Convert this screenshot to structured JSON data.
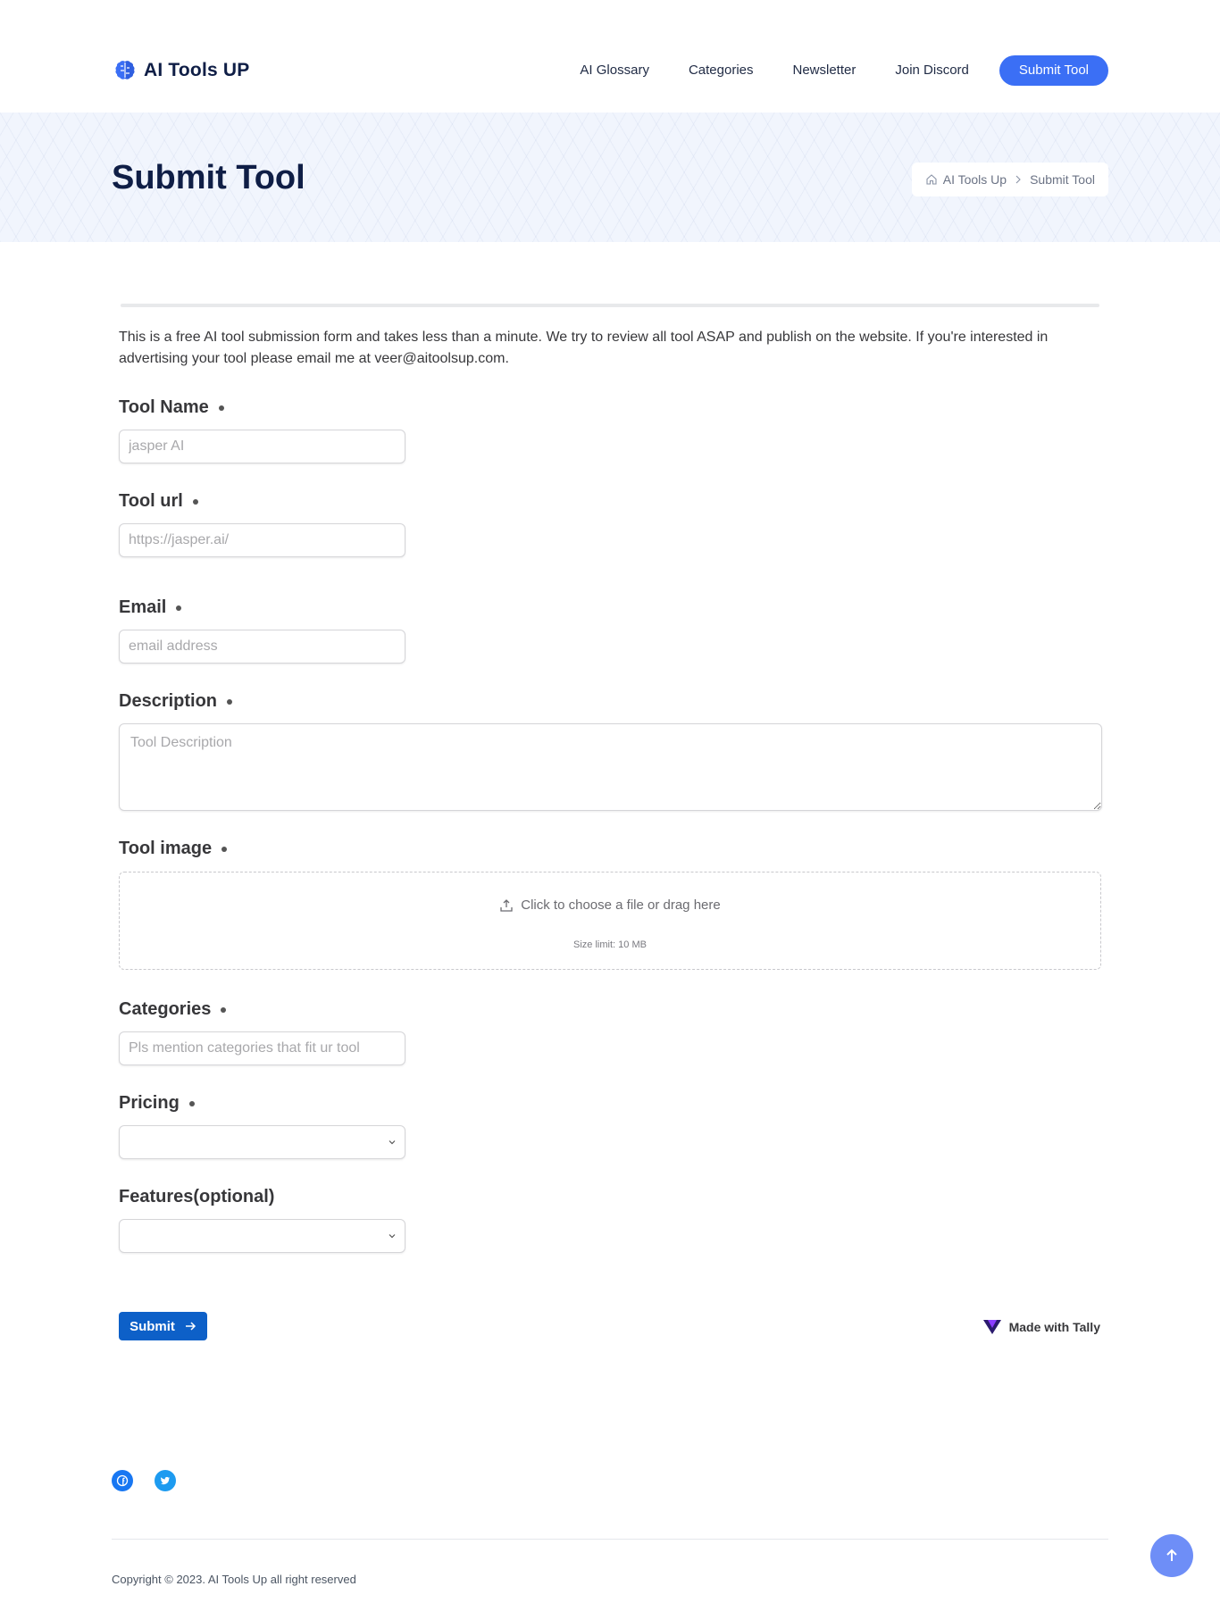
{
  "header": {
    "logo_text": "AI Tools UP",
    "nav": [
      "AI Glossary",
      "Categories",
      "Newsletter",
      "Join Discord"
    ],
    "cta": "Submit Tool"
  },
  "banner": {
    "title": "Submit Tool",
    "breadcrumb": [
      "AI Tools Up",
      "Submit Tool"
    ]
  },
  "form": {
    "intro": "This is a free AI tool submission form and takes less than a minute. We try to review all tool ASAP and publish on the website. If you're interested in advertising your tool please email me at veer@aitoolsup.com.",
    "fields": {
      "tool_name": {
        "label": "Tool Name",
        "placeholder": "jasper AI"
      },
      "tool_url": {
        "label": "Tool url",
        "placeholder": "https://jasper.ai/"
      },
      "email": {
        "label": "Email",
        "placeholder": "email address"
      },
      "description": {
        "label": "Description",
        "placeholder": "Tool Description"
      },
      "tool_image": {
        "label": "Tool image",
        "upload_text": "Click to choose a file or drag here",
        "size_limit": "Size limit: 10 MB"
      },
      "categories": {
        "label": "Categories",
        "placeholder": "Pls mention categories that fit ur tool"
      },
      "pricing": {
        "label": "Pricing"
      },
      "features": {
        "label": "Features(optional)"
      }
    },
    "submit_label": "Submit",
    "made_with": "Made with Tally"
  },
  "footer": {
    "copyright": "Copyright © 2023. AI Tools Up all right reserved"
  },
  "colors": {
    "brand_blue": "#3b6ff5",
    "submit_blue": "#0d60c8",
    "title_navy": "#0f1e46"
  }
}
